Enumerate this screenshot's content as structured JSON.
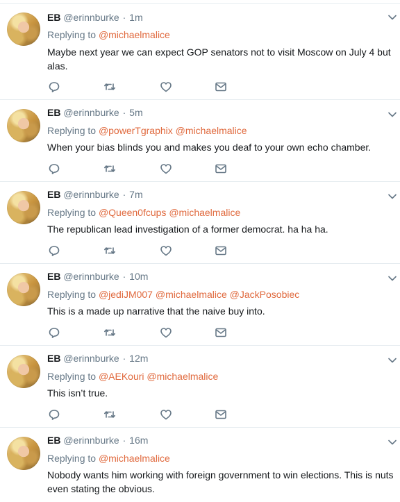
{
  "tweets": [
    {
      "name": "EB",
      "handle": "@erinnburke",
      "separator": "·",
      "time": "1m",
      "reply_prefix": "Replying to",
      "mentions": [
        "@michaelmalice"
      ],
      "text": "Maybe next year we can expect GOP senators not to visit Moscow on July 4 but alas."
    },
    {
      "name": "EB",
      "handle": "@erinnburke",
      "separator": "·",
      "time": "5m",
      "reply_prefix": "Replying to",
      "mentions": [
        "@powerTgraphix",
        "@michaelmalice"
      ],
      "text": "When your bias blinds you and makes you deaf to your own echo chamber."
    },
    {
      "name": "EB",
      "handle": "@erinnburke",
      "separator": "·",
      "time": "7m",
      "reply_prefix": "Replying to",
      "mentions": [
        "@Queen0fcups",
        "@michaelmalice"
      ],
      "text": "The republican lead investigation of a former democrat. ha ha ha."
    },
    {
      "name": "EB",
      "handle": "@erinnburke",
      "separator": "·",
      "time": "10m",
      "reply_prefix": "Replying to",
      "mentions": [
        "@jediJM007",
        "@michaelmalice",
        "@JackPosobiec"
      ],
      "text": "This is a made up narrative that the naive buy into."
    },
    {
      "name": "EB",
      "handle": "@erinnburke",
      "separator": "·",
      "time": "12m",
      "reply_prefix": "Replying to",
      "mentions": [
        "@AEKouri",
        "@michaelmalice"
      ],
      "text": "This isn’t true."
    },
    {
      "name": "EB",
      "handle": "@erinnburke",
      "separator": "·",
      "time": "16m",
      "reply_prefix": "Replying to",
      "mentions": [
        "@michaelmalice"
      ],
      "text": "Nobody wants him working with foreign government to win elections. This is nuts even stating the obvious."
    }
  ],
  "icons": {
    "reply": "reply-icon",
    "retweet": "retweet-icon",
    "like": "heart-icon",
    "message": "envelope-icon",
    "caret": "chevron-down-icon"
  },
  "colors": {
    "mention": "#e0693d",
    "muted": "#657786",
    "icon": "#657786",
    "divider": "#e6ecf0"
  }
}
